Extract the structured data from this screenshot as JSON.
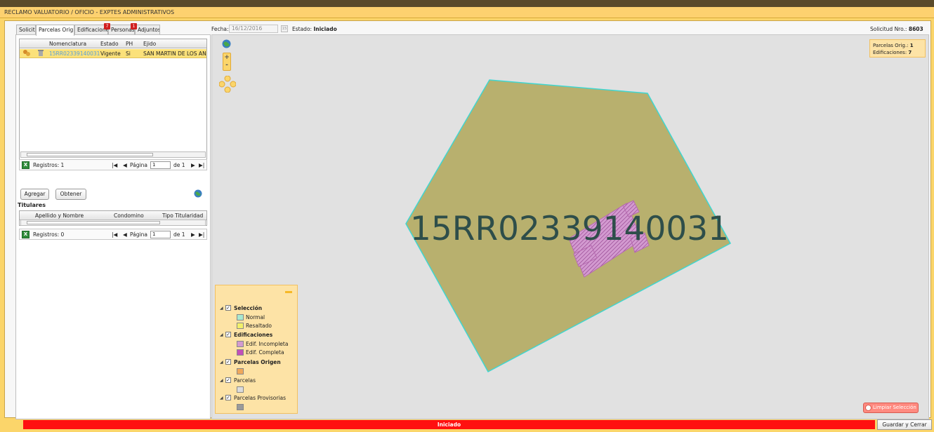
{
  "window": {
    "title": "RECLAMO VALUATORIO / OFICIO  -  EXPTES ADMINISTRATIVOS"
  },
  "tabs": [
    {
      "label": "Solicitu"
    },
    {
      "label": "Parcelas Orig."
    },
    {
      "label": "Edificaciones",
      "badge": "7"
    },
    {
      "label": "Personas",
      "badge": "1"
    },
    {
      "label": "Adjuntos"
    }
  ],
  "header": {
    "fecha_label": "Fecha:",
    "fecha_value": "16/12/2016",
    "calendar_glyph": "15",
    "estado_label": "Estado:",
    "estado_value": "Iniciado",
    "solicitud_label": "Solicitud Nro.:",
    "solicitud_value": "8603"
  },
  "parcelas": {
    "columns": [
      "Nomenclatura",
      "Estado",
      "PH",
      "Ejido"
    ],
    "rows": [
      {
        "nomenclatura": "15RR02339140031",
        "estado": "Vigente",
        "ph": "Si",
        "ejido": "SAN MARTIN DE LOS ANI"
      }
    ],
    "registros": "Registros: 1",
    "pagina_label": "Página",
    "pagina_value": "1",
    "de_label": "de 1"
  },
  "buttons": {
    "agregar": "Agregar",
    "obtener": "Obtener",
    "limpiar": "Limpiar Selección",
    "guardar": "Guardar y Cerrar"
  },
  "titulares": {
    "title": "Titulares",
    "columns": [
      "Apellido y Nombre",
      "Condomino",
      "Tipo Titularidad"
    ],
    "registros": "Registros: 0",
    "pagina_label": "Página",
    "pagina_value": "1",
    "de_label": "de 1"
  },
  "map": {
    "parcel_label": "15RR02339140031",
    "info": {
      "parcelas_label": "Parcelas Orig.:",
      "parcelas_value": "1",
      "edificaciones_label": "Edificaciones:",
      "edificaciones_value": "7"
    },
    "zoom_in": "+",
    "zoom_out": "-",
    "colors": {
      "parcel_fill": "#b8b06e",
      "parcel_stroke": "#3fd6d0",
      "building": "#b76bb0",
      "label": "#2e4e4a"
    }
  },
  "legend": {
    "groups": [
      {
        "label": "Selección",
        "bold": true,
        "items": [
          {
            "label": "Normal",
            "color": "#a9e8cf"
          },
          {
            "label": "Resaltado",
            "color": "#f2f06a"
          }
        ]
      },
      {
        "label": "Edificaciones",
        "bold": true,
        "items": [
          {
            "label": "Edif. Incompleta",
            "color": "#d39ad0"
          },
          {
            "label": "Edif. Completa",
            "color": "#c34fb9"
          }
        ]
      },
      {
        "label": "Parcelas Origen",
        "bold": true,
        "items": [
          {
            "label": "",
            "color": "#f0a85a"
          }
        ]
      },
      {
        "label": "Parcelas",
        "bold": false,
        "items": [
          {
            "label": "",
            "color": "#dcdcdc"
          }
        ]
      },
      {
        "label": "Parcelas Provisorias",
        "bold": false,
        "items": [
          {
            "label": "",
            "color": "#9a9a9a"
          }
        ]
      }
    ]
  },
  "status": {
    "text": "Iniciado"
  }
}
